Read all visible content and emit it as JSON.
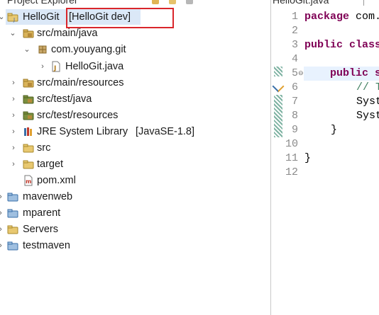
{
  "explorer": {
    "tab_title": "Project Explorer",
    "tree": [
      {
        "name": "HelloGit",
        "decoration": "[HelloGit dev]",
        "icon": "java-project-icon",
        "expanded": true
      },
      {
        "name": "src/main/java",
        "icon": "source-folder-icon",
        "expanded": true
      },
      {
        "name": "com.youyang.git",
        "icon": "package-icon",
        "expanded": true
      },
      {
        "name": "HelloGit.java",
        "icon": "java-file-icon",
        "expanded": false
      },
      {
        "name": "src/main/resources",
        "icon": "source-folder-icon",
        "expanded": false
      },
      {
        "name": "src/test/java",
        "icon": "source-folder-icon",
        "expanded": false
      },
      {
        "name": "src/test/resources",
        "icon": "source-folder-icon",
        "expanded": false
      },
      {
        "name": "JRE System Library",
        "decoration": "[JavaSE-1.8]",
        "icon": "library-icon",
        "expanded": false
      },
      {
        "name": "src",
        "icon": "folder-icon",
        "expanded": false
      },
      {
        "name": "target",
        "icon": "folder-icon",
        "expanded": false
      },
      {
        "name": "pom.xml",
        "icon": "xml-file-icon"
      },
      {
        "name": "mavenweb",
        "icon": "project-icon"
      },
      {
        "name": "mparent",
        "icon": "project-icon"
      },
      {
        "name": "Servers",
        "icon": "folder-icon"
      },
      {
        "name": "testmaven",
        "icon": "project-icon"
      }
    ]
  },
  "editor": {
    "tab_title": "HelloGit.java",
    "line_numbers": [
      "1",
      "2",
      "3",
      "4",
      "5",
      "6",
      "7",
      "8",
      "9",
      "10",
      "11",
      "12"
    ],
    "code": {
      "line1_kw": "package",
      "line1_rest": " com.",
      "line3_kw": "public class",
      "line5_kw": "public s",
      "line6_comment": "// T",
      "line7": "Syst",
      "line8": "Syst",
      "line9": "}",
      "line11": "}"
    }
  },
  "colors": {
    "selection": "#dbe8f7",
    "highlight_border": "#d9262b",
    "keyword": "#7f0055",
    "comment": "#3f7f5f",
    "decoration_text": "#8a7a45"
  }
}
